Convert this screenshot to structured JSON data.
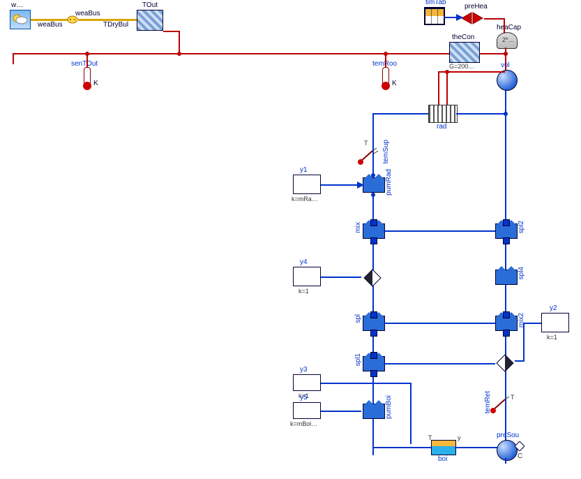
{
  "weather": {
    "title": "w…",
    "bus1": "weaBus",
    "bus2": "weaBus",
    "tdrybul": "TDryBul"
  },
  "tout": {
    "label": "TOut"
  },
  "senTOut": {
    "label": "senTOut",
    "unit": "K"
  },
  "temRoo": {
    "label": "temRoo",
    "unit": "K"
  },
  "timTab": {
    "label": "timTab"
  },
  "preHea": {
    "label": "preHea"
  },
  "heaCap": {
    "label": "heaCap",
    "param": "2*…"
  },
  "theCon": {
    "label": "theCon",
    "param": "G=200…"
  },
  "vol": {
    "label": "vol"
  },
  "rad": {
    "label": "rad"
  },
  "temSup": {
    "label": "temSup"
  },
  "pumRad": {
    "label": "pumRad"
  },
  "y1": {
    "label": "y1",
    "k": "k=mRa…"
  },
  "mix": {
    "label": "mix"
  },
  "y4": {
    "label": "y4",
    "k": "k=1"
  },
  "spl": {
    "label": "spl"
  },
  "spl1": {
    "label": "spl1"
  },
  "spl2": {
    "label": "spl2"
  },
  "spl4": {
    "label": "spl4"
  },
  "mix2": {
    "label": "mix2"
  },
  "y2": {
    "label": "y2",
    "k": "k=1"
  },
  "y3": {
    "label": "y3",
    "k": "k=1"
  },
  "y5": {
    "label": "y5",
    "k": "k=mBoi…"
  },
  "pumBoi": {
    "label": "pumBoi"
  },
  "boi": {
    "label": "boi"
  },
  "temRet": {
    "label": "temRet"
  },
  "preSou": {
    "label": "preSou"
  },
  "y_boi": "y",
  "T_boi": "T",
  "T_sup": "T",
  "T_ret": "T",
  "portC": "C"
}
